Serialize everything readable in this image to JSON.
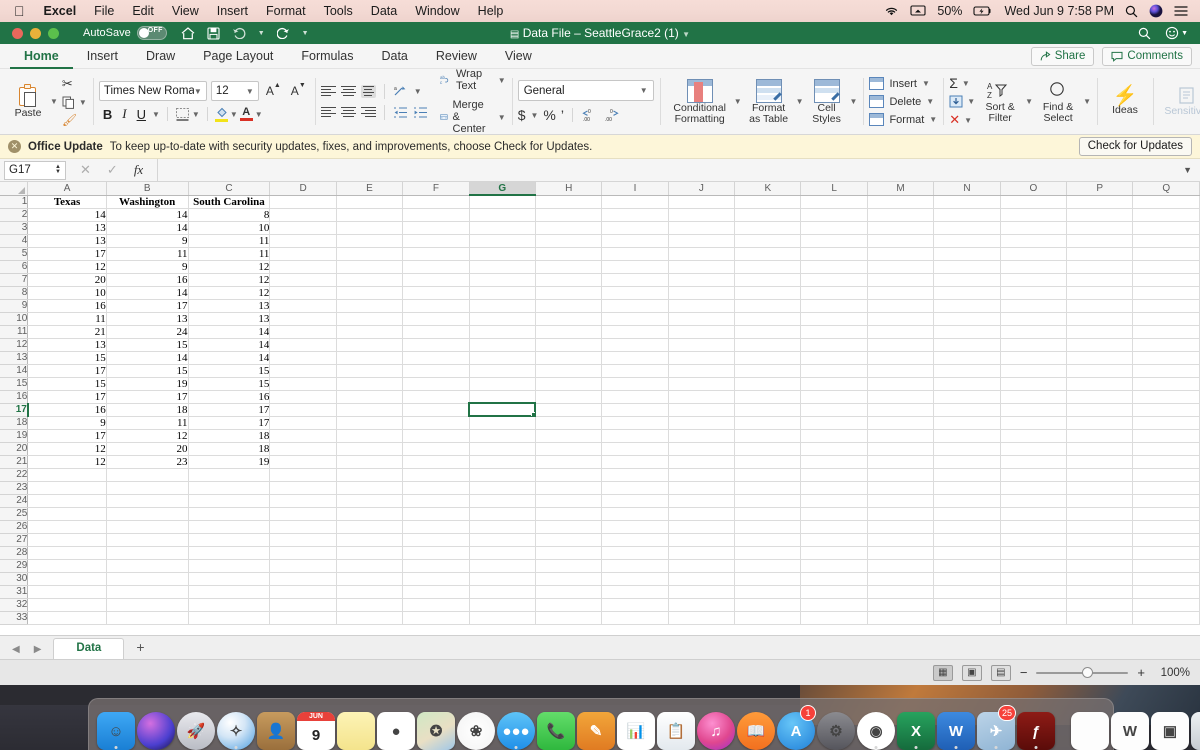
{
  "macmenu": {
    "apple_icon": "apple-icon",
    "items": [
      "Excel",
      "File",
      "Edit",
      "View",
      "Insert",
      "Format",
      "Tools",
      "Data",
      "Window",
      "Help"
    ],
    "status": {
      "wifi_icon": "wifi-icon",
      "airplay_icon": "airplay-icon",
      "battery": "50%",
      "battery_icon": "battery-charging-icon",
      "datetime": "Wed Jun 9  7:58 PM",
      "search_icon": "spotlight-search-icon",
      "siri_icon": "siri-icon",
      "controlcenter_icon": "notification-center-icon"
    }
  },
  "titlebar": {
    "autosave_label": "AutoSave",
    "autosave_state": "OFF",
    "doc_title": "Data File – SeattleGrace2 (1)",
    "doc_icon": "excel-doc-icon",
    "home_icon": "home-icon",
    "save_icon": "save-icon",
    "undo_icon": "undo-icon",
    "redo_icon": "redo-icon",
    "customize_icon": "customize-toolbar-icon",
    "search_icon": "search-icon",
    "account_icon": "smiley-account-icon"
  },
  "ribbon_tabs": {
    "items": [
      "Home",
      "Insert",
      "Draw",
      "Page Layout",
      "Formulas",
      "Data",
      "Review",
      "View"
    ],
    "active": "Home",
    "share_label": "Share",
    "comments_label": "Comments"
  },
  "ribbon": {
    "clipboard": {
      "paste_label": "Paste",
      "cut_icon": "scissors-icon",
      "copy_icon": "copy-icon",
      "format_painter_icon": "format-painter-icon"
    },
    "font": {
      "family": "Times New Roman",
      "size": "12",
      "grow_label": "A",
      "shrink_label": "A",
      "bold": "B",
      "italic": "I",
      "underline": "U",
      "borders_icon": "borders-icon",
      "fill_color_icon": "fill-color-icon",
      "font_color_icon": "font-color-icon"
    },
    "alignment": {
      "wrap_text": "Wrap Text",
      "merge_center": "Merge & Center",
      "orientation_icon": "text-orientation-icon",
      "decrease_indent_icon": "decrease-indent-icon",
      "increase_indent_icon": "increase-indent-icon"
    },
    "number": {
      "format": "General",
      "currency_icon": "currency-icon",
      "percent_icon": "percent-icon",
      "comma_icon": "comma-style-icon",
      "increase_decimal_icon": "increase-decimal-icon",
      "decrease_decimal_icon": "decrease-decimal-icon"
    },
    "styles": {
      "conditional_formatting": "Conditional\nFormatting",
      "conditional_formatting_l1": "Conditional",
      "conditional_formatting_l2": "Formatting",
      "format_as_table_l1": "Format",
      "format_as_table_l2": "as Table",
      "cell_styles_l1": "Cell",
      "cell_styles_l2": "Styles"
    },
    "cells": {
      "insert": "Insert",
      "delete": "Delete",
      "format": "Format"
    },
    "editing": {
      "autosum_icon": "autosum-icon",
      "fill_icon": "fill-down-icon",
      "clear_icon": "clear-icon",
      "sort_filter_l1": "Sort &",
      "sort_filter_l2": "Filter",
      "find_select_l1": "Find &",
      "find_select_l2": "Select"
    },
    "ideas": {
      "label": "Ideas",
      "icon": "ideas-bolt-icon"
    },
    "sensitivity": {
      "label": "Sensitivity",
      "icon": "sensitivity-icon"
    }
  },
  "update_bar": {
    "icon": "close-circle-icon",
    "title": "Office Update",
    "message": "To keep up-to-date with security updates, fixes, and improvements, choose Check for Updates.",
    "button": "Check for Updates"
  },
  "formula_bar": {
    "name_box": "G17",
    "cancel_icon": "cancel-icon",
    "enter_icon": "enter-icon",
    "fx_icon": "insert-function-icon",
    "formula_value": "",
    "expand_icon": "expand-formula-bar-icon"
  },
  "grid": {
    "columns": [
      "A",
      "B",
      "C",
      "D",
      "E",
      "F",
      "G",
      "H",
      "I",
      "J",
      "K",
      "L",
      "M",
      "N",
      "O",
      "P",
      "Q"
    ],
    "selected_column": "G",
    "selected_row": 17,
    "selected_cell": "G17",
    "first_row": 1,
    "last_row": 33,
    "headers": [
      "Texas",
      "Washington",
      "South Carolina"
    ],
    "rows": [
      {
        "r": 2,
        "a": "14",
        "b": "14",
        "c": "8"
      },
      {
        "r": 3,
        "a": "13",
        "b": "14",
        "c": "10"
      },
      {
        "r": 4,
        "a": "13",
        "b": "9",
        "c": "11"
      },
      {
        "r": 5,
        "a": "17",
        "b": "11",
        "c": "11"
      },
      {
        "r": 6,
        "a": "12",
        "b": "9",
        "c": "12"
      },
      {
        "r": 7,
        "a": "20",
        "b": "16",
        "c": "12"
      },
      {
        "r": 8,
        "a": "10",
        "b": "14",
        "c": "12"
      },
      {
        "r": 9,
        "a": "16",
        "b": "17",
        "c": "13"
      },
      {
        "r": 10,
        "a": "11",
        "b": "13",
        "c": "13"
      },
      {
        "r": 11,
        "a": "21",
        "b": "24",
        "c": "14"
      },
      {
        "r": 12,
        "a": "13",
        "b": "15",
        "c": "14"
      },
      {
        "r": 13,
        "a": "15",
        "b": "14",
        "c": "14"
      },
      {
        "r": 14,
        "a": "17",
        "b": "15",
        "c": "15"
      },
      {
        "r": 15,
        "a": "15",
        "b": "19",
        "c": "15"
      },
      {
        "r": 16,
        "a": "17",
        "b": "17",
        "c": "16"
      },
      {
        "r": 17,
        "a": "16",
        "b": "18",
        "c": "17"
      },
      {
        "r": 18,
        "a": "9",
        "b": "11",
        "c": "17"
      },
      {
        "r": 19,
        "a": "17",
        "b": "12",
        "c": "18"
      },
      {
        "r": 20,
        "a": "12",
        "b": "20",
        "c": "18"
      },
      {
        "r": 21,
        "a": "12",
        "b": "23",
        "c": "19"
      }
    ]
  },
  "sheet_tabs": {
    "prev_icon": "previous-sheet-icon",
    "next_icon": "next-sheet-icon",
    "tabs": [
      "Data"
    ],
    "active": "Data",
    "add_label": "+"
  },
  "status_bar": {
    "normal_view_icon": "normal-view-icon",
    "page_layout_icon": "page-layout-view-icon",
    "page_break_icon": "page-break-view-icon",
    "zoom_out": "−",
    "zoom_in": "+",
    "zoom_level": "100%"
  },
  "dock": {
    "items": [
      {
        "name": "finder",
        "badge": null,
        "running": true
      },
      {
        "name": "siri",
        "badge": null,
        "running": false
      },
      {
        "name": "launchpad",
        "badge": null,
        "running": false
      },
      {
        "name": "safari",
        "badge": null,
        "running": true
      },
      {
        "name": "contacts",
        "badge": null,
        "running": false
      },
      {
        "name": "calendar",
        "badge": null,
        "running": false,
        "label": "JUN",
        "day": "9"
      },
      {
        "name": "notes",
        "badge": null,
        "running": false
      },
      {
        "name": "reminders",
        "badge": null,
        "running": false
      },
      {
        "name": "maps",
        "badge": null,
        "running": false
      },
      {
        "name": "photos",
        "badge": null,
        "running": false
      },
      {
        "name": "messages",
        "badge": null,
        "running": true
      },
      {
        "name": "facetime",
        "badge": null,
        "running": false
      },
      {
        "name": "pages",
        "badge": null,
        "running": false
      },
      {
        "name": "numbers",
        "badge": null,
        "running": false
      },
      {
        "name": "keynote",
        "badge": null,
        "running": false
      },
      {
        "name": "itunes",
        "badge": null,
        "running": false
      },
      {
        "name": "ibooks",
        "badge": null,
        "running": false
      },
      {
        "name": "app-store",
        "badge": "1",
        "running": false
      },
      {
        "name": "system-preferences",
        "badge": null,
        "running": false
      },
      {
        "name": "chrome",
        "badge": null,
        "running": true
      },
      {
        "name": "excel",
        "badge": null,
        "running": true
      },
      {
        "name": "word",
        "badge": null,
        "running": true
      },
      {
        "name": "mail",
        "badge": "25",
        "running": true
      },
      {
        "name": "flash-player",
        "badge": null,
        "running": true
      },
      {
        "name": "blank-document",
        "badge": null,
        "running": false
      },
      {
        "name": "word-document",
        "badge": null,
        "running": false
      },
      {
        "name": "preview-document",
        "badge": null,
        "running": false
      },
      {
        "name": "trash",
        "badge": null,
        "running": false
      }
    ]
  }
}
